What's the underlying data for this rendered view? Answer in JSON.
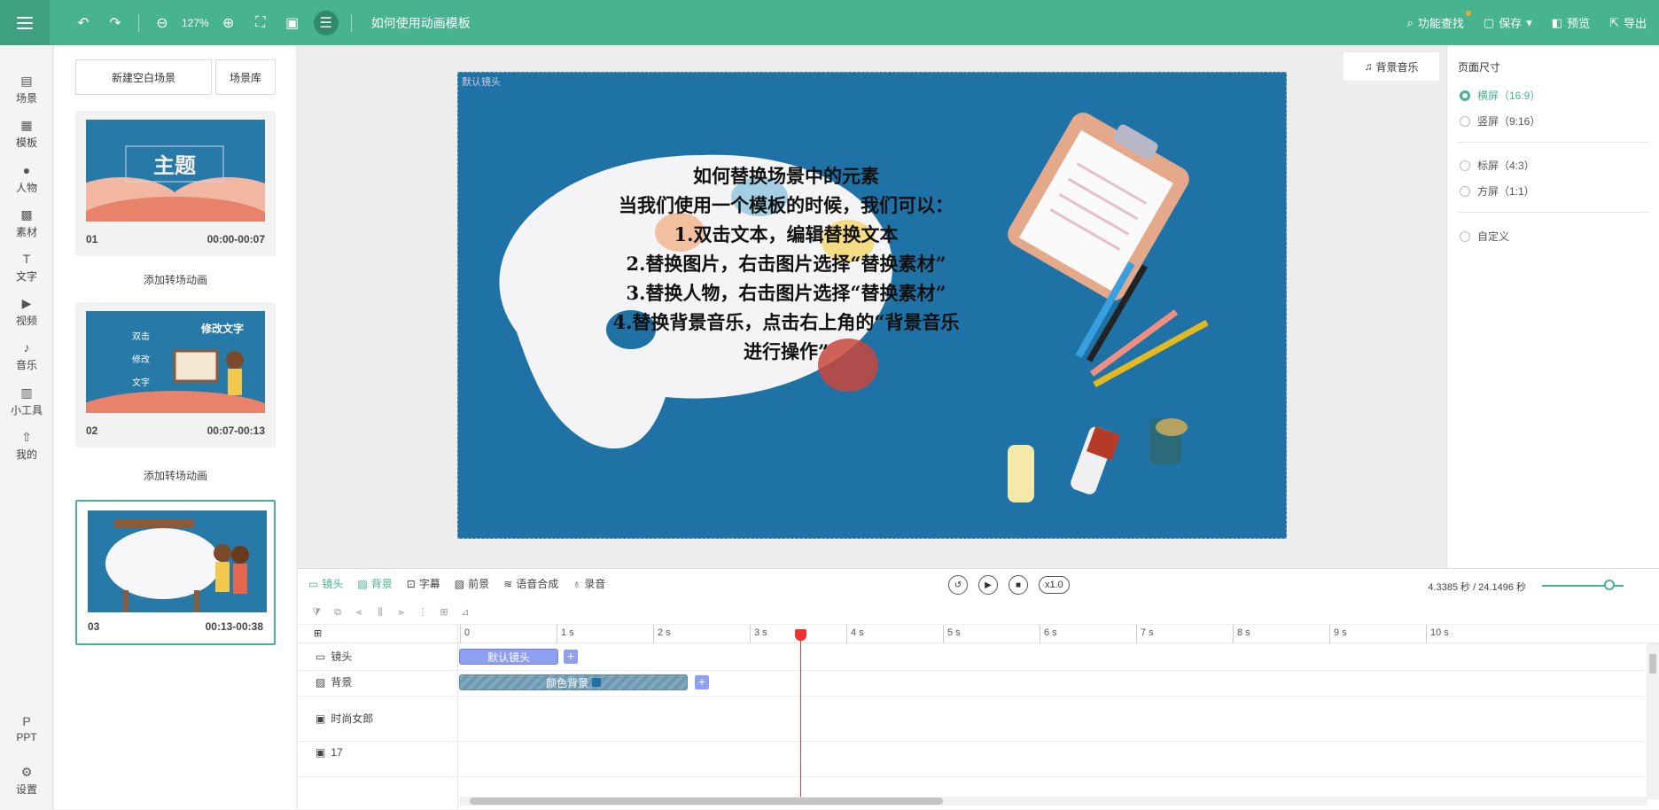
{
  "toolbar": {
    "zoom": "127%",
    "title": "如何使用动画模板",
    "feature_search": "功能查找",
    "save": "保存",
    "preview": "预览",
    "export": "导出"
  },
  "nav": {
    "items": [
      {
        "label": "场景",
        "icon": "scene-icon"
      },
      {
        "label": "模板",
        "icon": "template-icon"
      },
      {
        "label": "人物",
        "icon": "person-icon"
      },
      {
        "label": "素材",
        "icon": "material-icon"
      },
      {
        "label": "文字",
        "icon": "text-icon"
      },
      {
        "label": "视频",
        "icon": "video-icon"
      },
      {
        "label": "音乐",
        "icon": "music-icon"
      },
      {
        "label": "小工具",
        "icon": "toolbox-icon"
      },
      {
        "label": "我的",
        "icon": "upload-icon"
      }
    ],
    "ppt": "PPT",
    "settings": "设置"
  },
  "scenes": {
    "new_blank": "新建空白场景",
    "library": "场景库",
    "add_transition": "添加转场动画",
    "list": [
      {
        "num": "01",
        "time": "00:00-00:07",
        "thumb_text": "主题"
      },
      {
        "num": "02",
        "time": "00:07-00:13",
        "thumb_text": "修改文字"
      },
      {
        "num": "03",
        "time": "00:13-00:38",
        "thumb_text": ""
      }
    ],
    "thumb2_lines": [
      "双击",
      "修改",
      "文字"
    ]
  },
  "canvas": {
    "music_button": "背景音乐",
    "camera_label": "默认镜头",
    "lines": [
      "如何替换场景中的元素",
      "当我们使用一个模板的时候，我们可以：",
      "1.双击文本，编辑替换文本",
      "2.替换图片，右击图片选择“替换素材”",
      "3.替换人物，右击图片选择“替换素材”",
      "4.替换背景音乐，点击右上角的“背景音乐",
      "进行操作”"
    ],
    "bg_color": "#1f72a6"
  },
  "props": {
    "title": "页面尺寸",
    "options": [
      {
        "label": "横屏（16:9）",
        "selected": true
      },
      {
        "label": "竖屏（9:16）",
        "selected": false
      },
      {
        "label": "标屏（4:3）",
        "selected": false
      },
      {
        "label": "方屏（1:1）",
        "selected": false
      },
      {
        "label": "自定义",
        "selected": false
      }
    ]
  },
  "timeline": {
    "tabs": [
      "镜头",
      "背景",
      "字幕",
      "前景",
      "语音合成",
      "录音"
    ],
    "speed": "x1.0",
    "time_readout": "4.3385 秒 / 24.1496 秒",
    "ruler": [
      "0",
      "1 s",
      "2 s",
      "3 s",
      "4 s",
      "5 s",
      "6 s",
      "7 s",
      "8 s",
      "9 s",
      "10 s"
    ],
    "tracks": [
      "镜头",
      "背景",
      "时尚女郎",
      "17"
    ],
    "clip_camera": "默认镜头",
    "clip_background": "颜色背景",
    "add": "+",
    "accent": "#48b38f"
  }
}
